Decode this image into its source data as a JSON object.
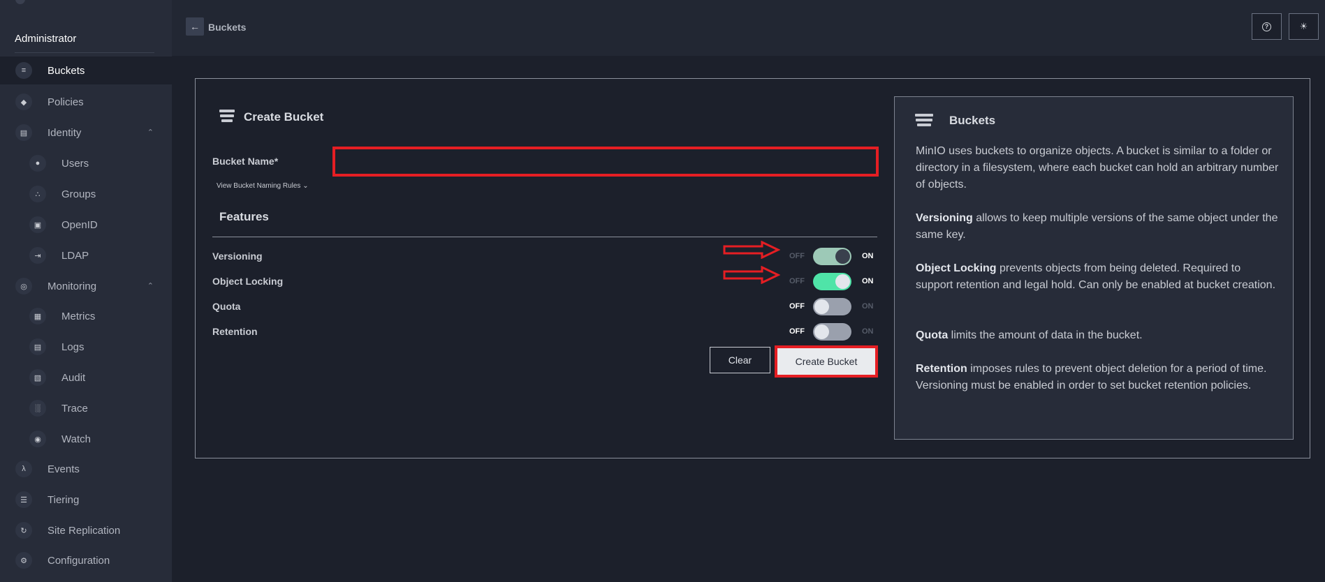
{
  "sidebar": {
    "heading": "Administrator",
    "items": [
      {
        "label": "Buckets",
        "icon": "bucket-icon",
        "glyph": "≡"
      },
      {
        "label": "Policies",
        "icon": "shield-icon",
        "glyph": "◆"
      },
      {
        "label": "Identity",
        "icon": "id-card-icon",
        "glyph": "▤"
      },
      {
        "label": "Users",
        "icon": "user-icon",
        "glyph": "●"
      },
      {
        "label": "Groups",
        "icon": "group-icon",
        "glyph": "∴"
      },
      {
        "label": "OpenID",
        "icon": "lock-icon",
        "glyph": "▣"
      },
      {
        "label": "LDAP",
        "icon": "login-icon",
        "glyph": "⇥"
      },
      {
        "label": "Monitoring",
        "icon": "search-icon",
        "glyph": "◎"
      },
      {
        "label": "Metrics",
        "icon": "dashboard-icon",
        "glyph": "▦"
      },
      {
        "label": "Logs",
        "icon": "logs-icon",
        "glyph": "▤"
      },
      {
        "label": "Audit",
        "icon": "audit-icon",
        "glyph": "▧"
      },
      {
        "label": "Trace",
        "icon": "trace-icon",
        "glyph": "░"
      },
      {
        "label": "Watch",
        "icon": "watch-icon",
        "glyph": "◉"
      },
      {
        "label": "Events",
        "icon": "lambda-icon",
        "glyph": "λ"
      },
      {
        "label": "Tiering",
        "icon": "layers-icon",
        "glyph": "☰"
      },
      {
        "label": "Site Replication",
        "icon": "replication-icon",
        "glyph": "↻"
      },
      {
        "label": "Configuration",
        "icon": "gear-icon",
        "glyph": "⚙"
      }
    ]
  },
  "header": {
    "back_glyph": "←",
    "breadcrumb": "Buckets",
    "help_glyph": "?",
    "theme_glyph": "☀"
  },
  "form": {
    "title": "Create Bucket",
    "bucket_name_label": "Bucket Name*",
    "bucket_name_value": "",
    "naming_rules_link": "View Bucket Naming Rules ⌄",
    "features_title": "Features",
    "features": [
      {
        "label": "Versioning",
        "state": "on"
      },
      {
        "label": "Object Locking",
        "state": "on"
      },
      {
        "label": "Quota",
        "state": "off"
      },
      {
        "label": "Retention",
        "state": "off"
      }
    ],
    "toggle_off_text": "OFF",
    "toggle_on_text": "ON",
    "clear_label": "Clear",
    "create_label": "Create Bucket"
  },
  "help": {
    "title": "Buckets",
    "intro": "MinIO uses buckets to organize objects. A bucket is similar to a folder or directory in a filesystem, where each bucket can hold an arbitrary number of objects.",
    "versioning_term": "Versioning",
    "versioning_text": " allows to keep multiple versions of the same object under the same key.",
    "locking_term": "Object Locking",
    "locking_text": " prevents objects from being deleted. Required to support retention and legal hold. Can only be enabled at bucket creation.",
    "quota_term": "Quota",
    "quota_text": " limits the amount of data in the bucket.",
    "retention_term": "Retention",
    "retention_text": " imposes rules to prevent object deletion for a period of time. Versioning must be enabled in order to set bucket retention policies."
  },
  "colors": {
    "highlight": "#e51e23",
    "toggle_on_green": "#4fe4a8",
    "background": "#1c202b",
    "sidebar": "#272c39"
  }
}
